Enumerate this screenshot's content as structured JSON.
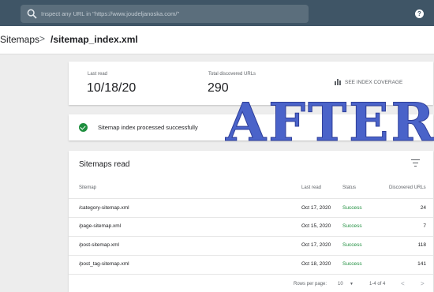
{
  "search": {
    "placeholder": "Inspect any URL in \"https://www.joudeljanoska.com/\""
  },
  "header": {
    "help_glyph": "?"
  },
  "breadcrumb": {
    "root": "Sitemaps",
    "separator": ">",
    "current": "/sitemap_index.xml"
  },
  "summary": {
    "last_read_label": "Last read",
    "last_read_value": "10/18/20",
    "discovered_label": "Total discovered URLs",
    "discovered_value": "290",
    "coverage_button": "SEE INDEX COVERAGE"
  },
  "status": {
    "message": "Sitemap index processed successfully"
  },
  "table": {
    "title": "Sitemaps read",
    "headers": {
      "sitemap": "Sitemap",
      "last_read": "Last read",
      "status": "Status",
      "discovered": "Discovered URLs"
    },
    "rows": [
      {
        "sitemap": "/category-sitemap.xml",
        "last_read": "Oct 17, 2020",
        "status": "Success",
        "discovered": "24"
      },
      {
        "sitemap": "/page-sitemap.xml",
        "last_read": "Oct 15, 2020",
        "status": "Success",
        "discovered": "7"
      },
      {
        "sitemap": "/post-sitemap.xml",
        "last_read": "Oct 17, 2020",
        "status": "Success",
        "discovered": "118"
      },
      {
        "sitemap": "/post_tag-sitemap.xml",
        "last_read": "Oct 18, 2020",
        "status": "Success",
        "discovered": "141"
      }
    ],
    "pager": {
      "rows_label": "Rows per page:",
      "rows_value": "10",
      "range": "1-4 of 4",
      "prev": "<",
      "next": ">"
    }
  },
  "overlay": {
    "text": "AFTER"
  },
  "colors": {
    "topbar": "#3f5566",
    "success": "#1e8e3e",
    "overlay": "#4a63c9"
  },
  "icons": [
    "search-icon",
    "help-icon",
    "chevron-right-icon",
    "bar-chart-icon",
    "check-circle-icon",
    "filter-icon",
    "dropdown-icon",
    "chevron-left-icon",
    "chevron-right-icon"
  ]
}
